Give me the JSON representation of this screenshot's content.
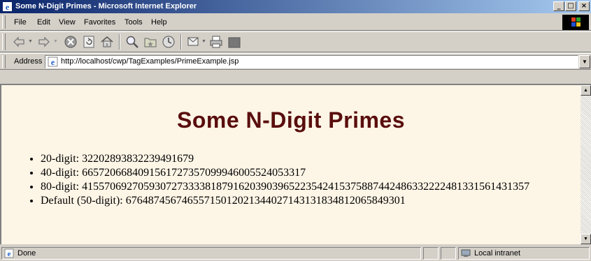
{
  "window": {
    "title": "Some N-Digit Primes - Microsoft Internet Explorer",
    "minimize": "_",
    "maximize": "□",
    "close": "×"
  },
  "menu": [
    {
      "label": "File"
    },
    {
      "label": "Edit"
    },
    {
      "label": "View"
    },
    {
      "label": "Favorites"
    },
    {
      "label": "Tools"
    },
    {
      "label": "Help"
    }
  ],
  "address": {
    "label": "Address",
    "value": "http://localhost/cwp/TagExamples/PrimeExample.jsp"
  },
  "page": {
    "title": "Some N-Digit Primes",
    "items": [
      "20-digit: 32202893832239491679",
      "40-digit: 6657206684091561727357099946005524053317",
      "80-digit: 41557069270593072733338187916203903965223542415375887442486332222481331561431357",
      "Default (50-digit): 67648745674655715012021344027143131834812065849301"
    ]
  },
  "status": {
    "text": "Done",
    "zone": "Local intranet"
  },
  "colors": {
    "titlebar_start": "#0a246a",
    "titlebar_end": "#a6caf0",
    "page_background": "#fdf5e6",
    "heading": "#5a0e0e"
  }
}
